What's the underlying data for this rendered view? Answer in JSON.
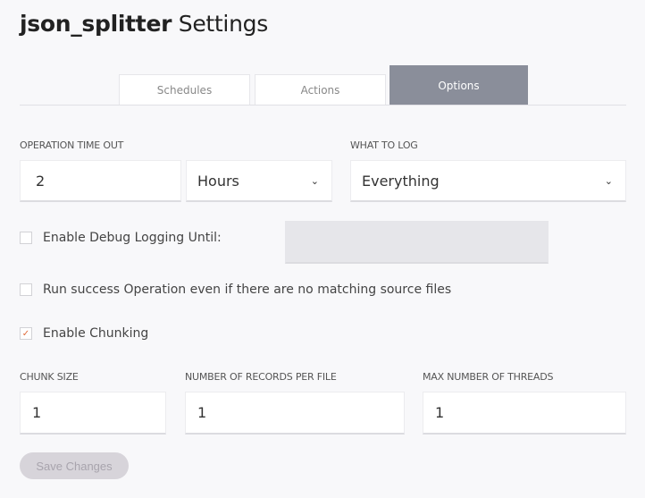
{
  "header": {
    "app_name": "json_splitter",
    "title_suffix": "Settings"
  },
  "tabs": [
    {
      "label": "Schedules",
      "active": false
    },
    {
      "label": "Actions",
      "active": false
    },
    {
      "label": "Options",
      "active": true
    }
  ],
  "operation_timeout": {
    "label": "OPERATION TIME OUT",
    "value": "2",
    "unit": "Hours"
  },
  "what_to_log": {
    "label": "WHAT TO LOG",
    "value": "Everything"
  },
  "checkboxes": [
    {
      "label": "Enable Debug Logging Until:",
      "checked": false,
      "check_glyph": ""
    },
    {
      "label": "Run success Operation even if there are no matching source files",
      "checked": false,
      "check_glyph": ""
    },
    {
      "label": "Enable Chunking",
      "checked": true,
      "check_glyph": "✓"
    }
  ],
  "debug_until": {
    "value": ""
  },
  "chunking": {
    "chunk_size": {
      "label": "CHUNK SIZE",
      "value": "1"
    },
    "records_per_file": {
      "label": "NUMBER OF RECORDS PER FILE",
      "value": "1"
    },
    "max_threads": {
      "label": "MAX NUMBER OF THREADS",
      "value": "1"
    }
  },
  "icons": {
    "chevron": "⌄"
  },
  "save_button": {
    "label": "Save Changes",
    "enabled": false
  },
  "colors": {
    "active_tab": "#8a8e9a",
    "check_accent": "#e06a3a",
    "save_disabled_bg": "#d7d4da"
  }
}
